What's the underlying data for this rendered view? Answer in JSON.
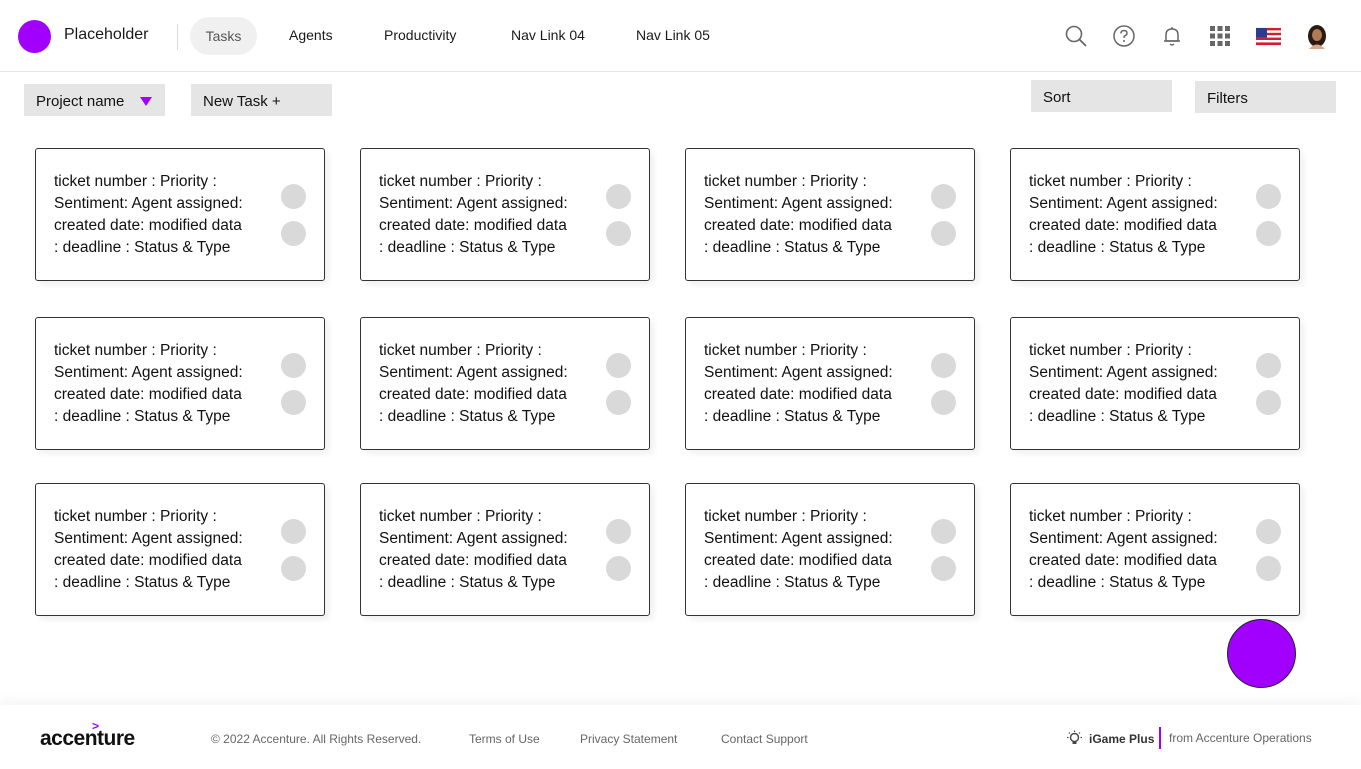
{
  "header": {
    "brand": "Placeholder",
    "nav": [
      "Tasks",
      "Agents",
      "Productivity",
      "Nav Link 04",
      "Nav Link 05"
    ],
    "active_index": 0,
    "icons": [
      "search-icon",
      "help-icon",
      "bell-icon",
      "apps-grid-icon",
      "us-flag-icon",
      "user-avatar"
    ]
  },
  "toolbar": {
    "project_label": "Project name",
    "new_task_label": "New Task +",
    "sort_label": "Sort",
    "filters_label": "Filters"
  },
  "card_text": "ticket number : Priority :\nSentiment: Agent assigned:\ncreated date: modified data\n:  deadline  : Status & Type",
  "cards": [
    {
      "text": "ticket number : Priority :\nSentiment: Agent assigned:\ncreated date: modified data\n:  deadline  : Status & Type"
    },
    {
      "text": "ticket number : Priority :\nSentiment: Agent assigned:\ncreated date: modified data\n:  deadline  : Status & Type"
    },
    {
      "text": "ticket number : Priority :\nSentiment: Agent assigned:\ncreated date: modified data\n:  deadline  : Status & Type"
    },
    {
      "text": "ticket number : Priority :\nSentiment: Agent assigned:\ncreated date: modified data\n:  deadline  : Status & Type"
    },
    {
      "text": "ticket number : Priority :\nSentiment: Agent assigned:\ncreated date: modified data\n:  deadline  : Status & Type"
    },
    {
      "text": "ticket number : Priority :\nSentiment: Agent assigned:\ncreated date: modified data\n:  deadline  : Status & Type"
    },
    {
      "text": "ticket number : Priority :\nSentiment: Agent assigned:\ncreated date: modified data\n:  deadline  : Status & Type"
    },
    {
      "text": "ticket number : Priority :\nSentiment: Agent assigned:\ncreated date: modified data\n:  deadline  : Status & Type"
    },
    {
      "text": "ticket number : Priority :\nSentiment: Agent assigned:\ncreated date: modified data\n:  deadline  : Status & Type"
    },
    {
      "text": "ticket number : Priority :\nSentiment: Agent assigned:\ncreated date: modified data\n:  deadline  : Status & Type"
    },
    {
      "text": "ticket number : Priority :\nSentiment: Agent assigned:\ncreated date: modified data\n:  deadline  : Status & Type"
    },
    {
      "text": "ticket number : Priority :\nSentiment: Agent assigned:\ncreated date: modified data\n:  deadline  : Status & Type"
    }
  ],
  "footer": {
    "logo": "accenture",
    "logo_mark": ">",
    "copyright": "© 2022 Accenture. All Rights Reserved.",
    "terms": "Terms of Use",
    "privacy": "Privacy Statement",
    "contact": "Contact Support",
    "product": "iGame Plus",
    "from": "from Accenture Operations"
  },
  "colors": {
    "accent": "#a100ff",
    "button_gray": "#e5e5e5",
    "dot_gray": "#d9d9d9"
  }
}
